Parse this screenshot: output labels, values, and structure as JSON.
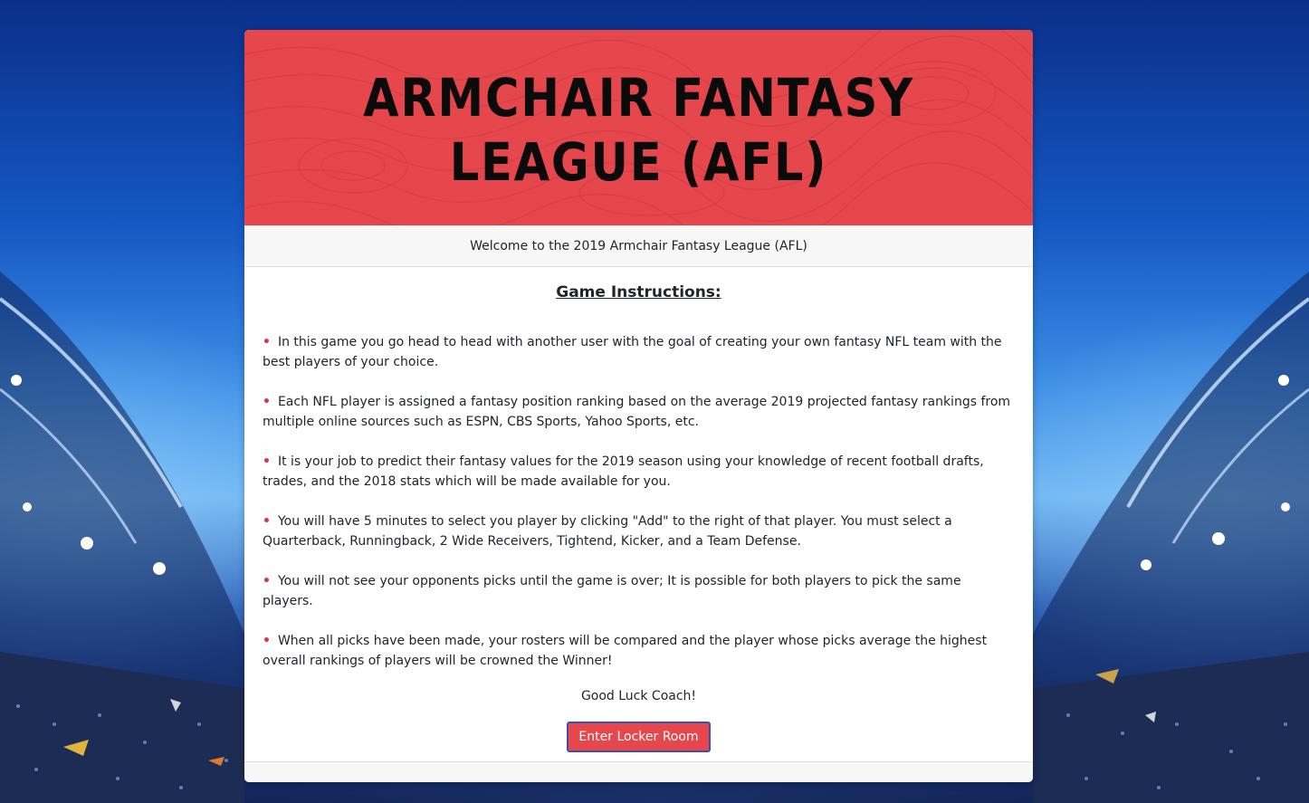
{
  "banner": {
    "title": "ARMCHAIR FANTASY LEAGUE (AFL)"
  },
  "subheader": {
    "text": "Welcome to the 2019 Armchair Fantasy League (AFL)"
  },
  "instructions": {
    "title": "Game Instructions:",
    "bullet": "•",
    "rules": [
      "In this game you go head to head with another user with the goal of creating your own fantasy NFL team with the best players of your choice.",
      "Each NFL player is assigned a fantasy position ranking based on the average 2019 projected fantasy rankings from multiple online sources such as ESPN, CBS Sports, Yahoo Sports, etc.",
      "It is your job to predict their fantasy values for the 2019 season using your knowledge of recent football drafts, trades, and the 2018 stats which will be made available for you.",
      "You will have 5 minutes to select you player by clicking \"Add\" to the right of that player. You must select a Quarterback, Runningback, 2 Wide Receivers, Tightend, Kicker, and a Team Defense.",
      "You will not see your opponents picks until the game is over; It is possible for both players to pick the same players.",
      "When all picks have been made, your rosters will be compared and the player whose picks average the highest overall rankings of players will be crowned the Winner!"
    ],
    "closing": "Good Luck Coach!"
  },
  "button": {
    "label": "Enter Locker Room"
  },
  "colors": {
    "banner": "#e5474d",
    "bullet": "#dc3545",
    "button": "#e5474d",
    "button_border": "#3b4fb8"
  }
}
